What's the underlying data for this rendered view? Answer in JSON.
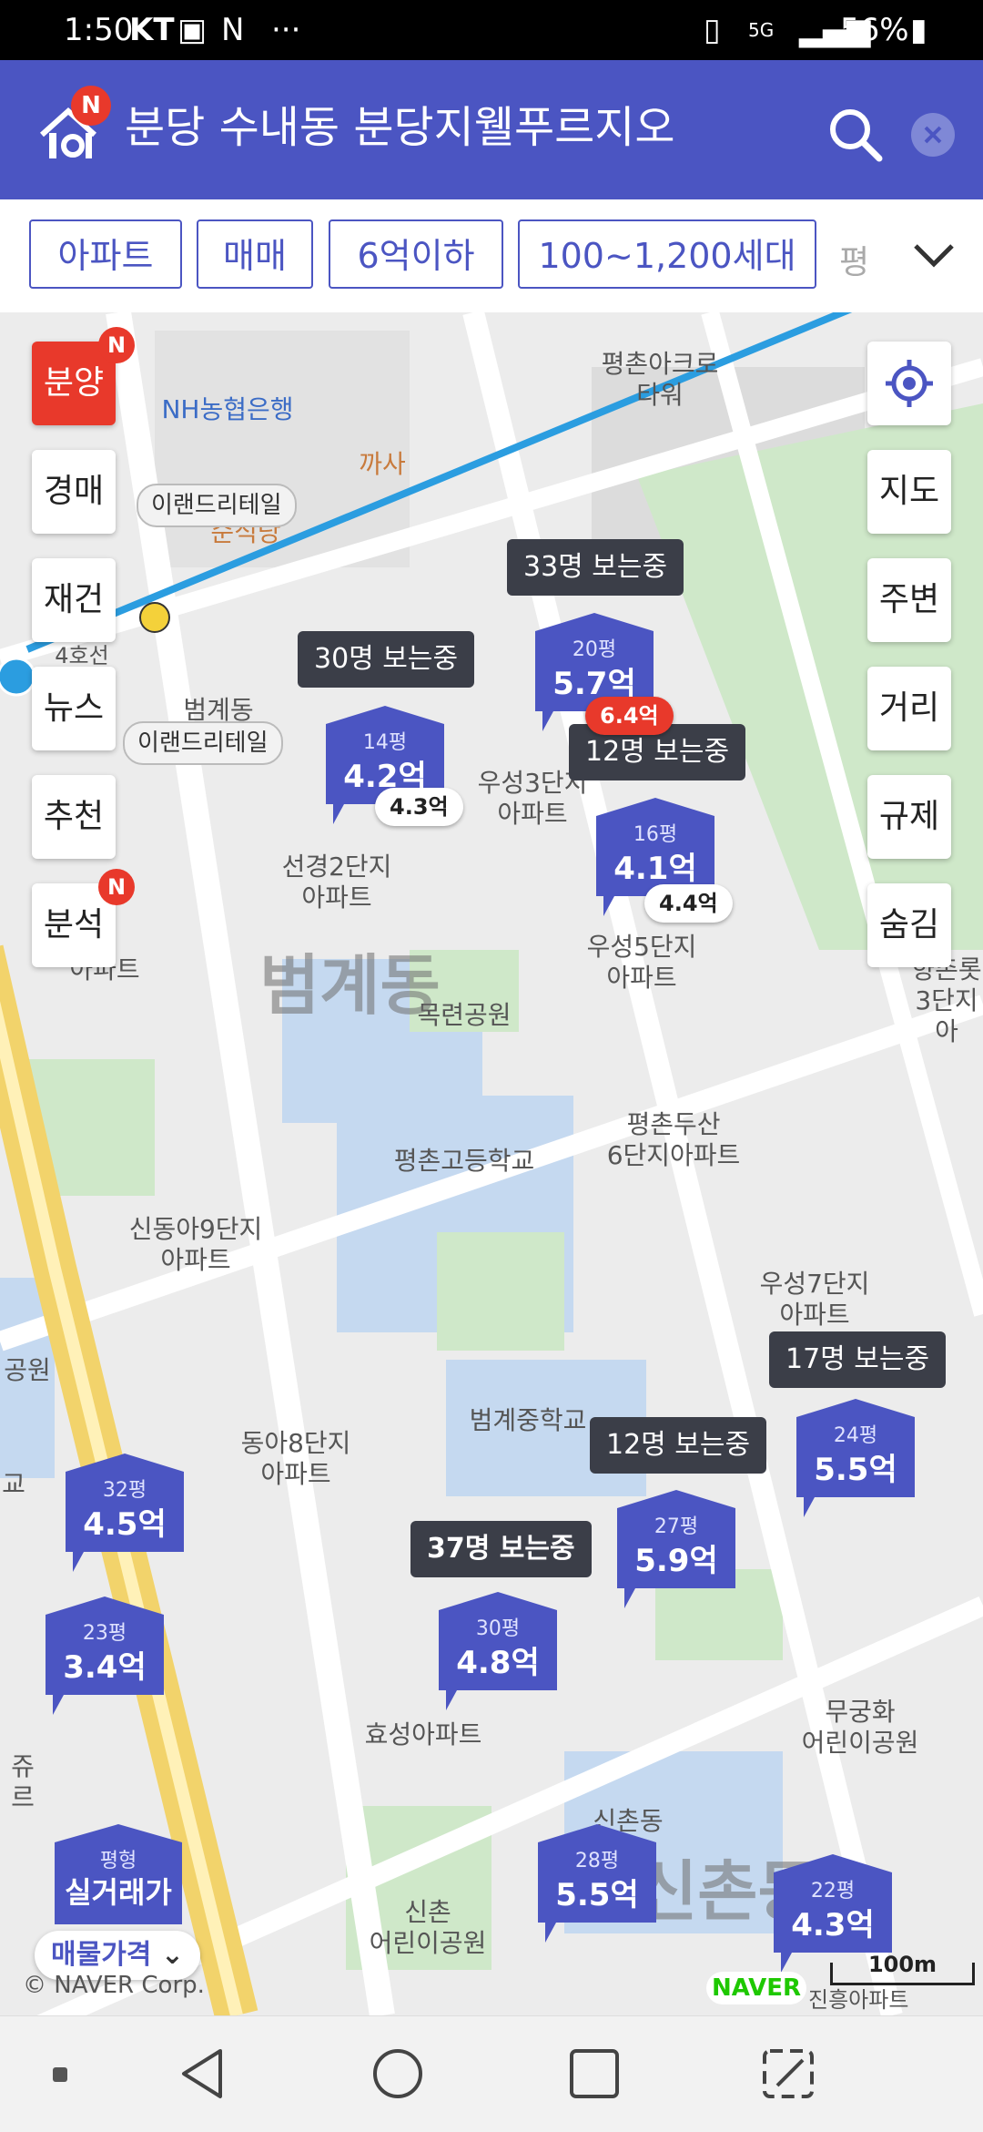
{
  "status_bar": {
    "time": "1:50",
    "carrier": "KT",
    "network": "5G",
    "battery": "56%"
  },
  "header": {
    "title": "분당 수내동 분당지웰푸르지오",
    "logo_badge": "N"
  },
  "filters": {
    "chips": [
      "아파트",
      "매매",
      "6억이하",
      "100~1,200세대"
    ],
    "more": "평"
  },
  "side_left": {
    "buttons": [
      "분양",
      "경매",
      "재건",
      "뉴스",
      "추천",
      "분석"
    ],
    "badge": "N"
  },
  "side_right": {
    "buttons": [
      "지도",
      "주변",
      "거리",
      "규제",
      "숨김"
    ]
  },
  "map_labels": {
    "nh_bank": "NH농협은행",
    "kkasa": "까사",
    "pyeongchon_acro": "평촌아크로\n타워",
    "sunsikdang": "순식당",
    "line4": "4호선",
    "beomgye_station": "범계동",
    "woosung3": "우성3단지\n아파트",
    "seongyeong2": "선경2단지\n아파트",
    "woosung5": "우성5단지\n아파트",
    "apt_left": "아파트",
    "mokryeon_park": "목련공원",
    "district_beomgye": "범계동",
    "pyeongchon_doosan": "평촌두산\n6단지아파트",
    "pyeongchon_high": "평촌고등학교",
    "sindonga9": "신동아9단지\n아파트",
    "woosung7": "우성7단지\n아파트",
    "beomgye_middle": "범계중학교",
    "donga8": "동아8단지\n아파트",
    "mugunghwa_park": "무궁화\n어린이공원",
    "hyosung": "효성아파트",
    "sinchon_park": "신촌\n어린이공원",
    "sinchondong": "신촌동",
    "district_sinchon": "신촌동",
    "yangchon": "향촌롯\n3단지아",
    "park_left": "공원",
    "school_left": "교",
    "juri_left": "쥬르",
    "copyright": "© NAVER Corp.",
    "scale": "100m",
    "naver_logo": "NAVER",
    "jinheung": "진흥아파트"
  },
  "shops": [
    "이랜드리테일",
    "이랜드리테일"
  ],
  "viewers": [
    "33명 보는중",
    "30명 보는중",
    "12명 보는중",
    "17명 보는중",
    "12명 보는중",
    "37명 보는중"
  ],
  "markers": [
    {
      "size": "20평",
      "price": "5.7억"
    },
    {
      "size": "14평",
      "price": "4.2억"
    },
    {
      "size": "16평",
      "price": "4.1억"
    },
    {
      "size": "24평",
      "price": "5.5억"
    },
    {
      "size": "32평",
      "price": "4.5억"
    },
    {
      "size": "27평",
      "price": "5.9억"
    },
    {
      "size": "30평",
      "price": "4.8억"
    },
    {
      "size": "23평",
      "price": "3.4억"
    },
    {
      "size": "28평",
      "price": "5.5억"
    },
    {
      "size": "22평",
      "price": "4.3억"
    }
  ],
  "pills": [
    "6.4억",
    "4.3억",
    "4.4억"
  ],
  "legend": {
    "size_label": "평형",
    "trade_label": "실거래가",
    "dropdown": "매물가격"
  },
  "colors": {
    "brand": "#4b55c2",
    "marker": "#4b55c2",
    "badge": "#e8392b"
  }
}
